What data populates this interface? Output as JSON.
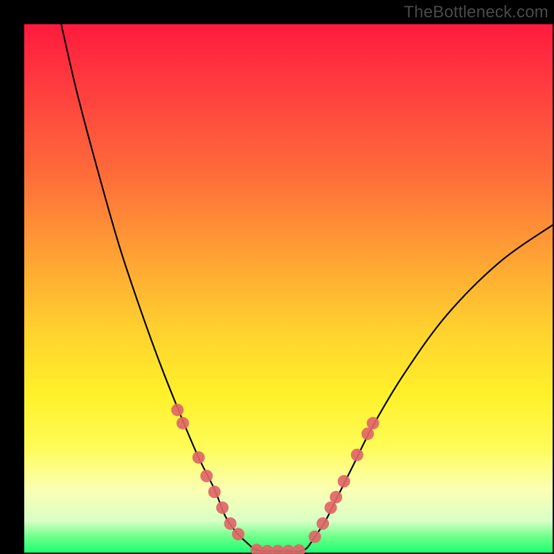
{
  "attribution": "TheBottleneck.com",
  "chart_data": {
    "type": "line",
    "title": "",
    "xlabel": "",
    "ylabel": "",
    "xlim": [
      0,
      100
    ],
    "ylim": [
      0,
      100
    ],
    "grid": false,
    "legend": false,
    "series": [
      {
        "name": "left-curve",
        "x": [
          7,
          10,
          14,
          18,
          22,
          26,
          30,
          33,
          36,
          38,
          40,
          42,
          44
        ],
        "y": [
          100,
          87,
          72,
          58,
          46,
          35,
          25,
          18,
          12,
          7,
          4,
          2,
          0.5
        ]
      },
      {
        "name": "right-curve",
        "x": [
          53,
          55,
          57,
          59,
          62,
          66,
          72,
          80,
          90,
          100
        ],
        "y": [
          0.5,
          3,
          6,
          10,
          16,
          24,
          34,
          45,
          55,
          62
        ]
      },
      {
        "name": "floor",
        "x": [
          44,
          47,
          50,
          53
        ],
        "y": [
          0.5,
          0.3,
          0.3,
          0.5
        ]
      }
    ],
    "markers": [
      {
        "name": "left-markers",
        "color": "#e06666",
        "points": [
          {
            "x": 29,
            "y": 27
          },
          {
            "x": 30,
            "y": 24.5
          },
          {
            "x": 33,
            "y": 18
          },
          {
            "x": 34.5,
            "y": 14.5
          },
          {
            "x": 36,
            "y": 11.5
          },
          {
            "x": 37.5,
            "y": 8.5
          },
          {
            "x": 39,
            "y": 5.5
          },
          {
            "x": 40.5,
            "y": 3.5
          }
        ]
      },
      {
        "name": "floor-markers",
        "color": "#e06666",
        "points": [
          {
            "x": 44,
            "y": 0.5
          },
          {
            "x": 46,
            "y": 0.3
          },
          {
            "x": 48,
            "y": 0.3
          },
          {
            "x": 50,
            "y": 0.3
          },
          {
            "x": 52,
            "y": 0.4
          }
        ]
      },
      {
        "name": "right-markers",
        "color": "#e06666",
        "points": [
          {
            "x": 55,
            "y": 3
          },
          {
            "x": 56.5,
            "y": 5.5
          },
          {
            "x": 58,
            "y": 8.5
          },
          {
            "x": 59,
            "y": 10.5
          },
          {
            "x": 60.5,
            "y": 13.5
          },
          {
            "x": 63,
            "y": 18.5
          },
          {
            "x": 65,
            "y": 22.5
          },
          {
            "x": 66,
            "y": 24.5
          }
        ]
      }
    ],
    "colors": {
      "curve": "#000000",
      "marker": "#e06666",
      "background_top": "#ff1a3e",
      "background_bottom": "#1bff70"
    }
  }
}
